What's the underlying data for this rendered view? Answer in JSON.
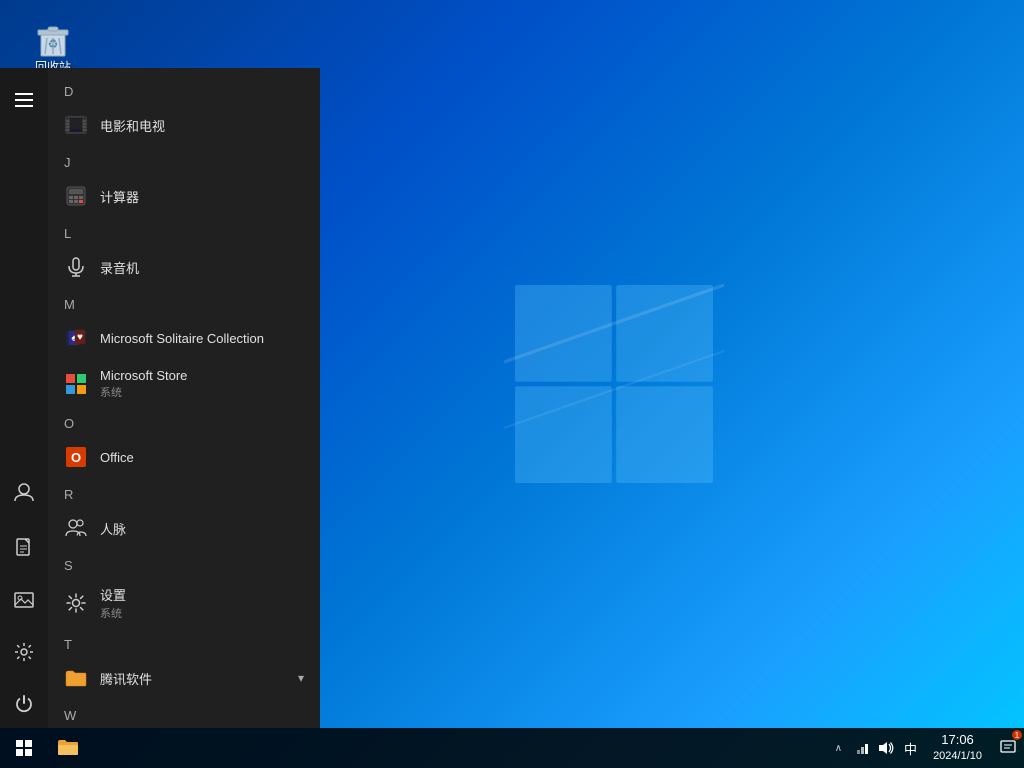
{
  "desktop": {
    "background_description": "Windows 10 blue gradient desktop",
    "icon_recycle": "回收站"
  },
  "start_menu": {
    "sections": [
      {
        "letter": "D",
        "items": [
          {
            "name": "电影和电视",
            "sub": "",
            "icon_type": "movie"
          }
        ]
      },
      {
        "letter": "J",
        "items": [
          {
            "name": "计算器",
            "sub": "",
            "icon_type": "calculator"
          }
        ]
      },
      {
        "letter": "L",
        "items": [
          {
            "name": "录音机",
            "sub": "",
            "icon_type": "microphone"
          }
        ]
      },
      {
        "letter": "M",
        "items": [
          {
            "name": "Microsoft Solitaire Collection",
            "sub": "",
            "icon_type": "solitaire"
          },
          {
            "name": "Microsoft Store",
            "sub": "系统",
            "icon_type": "store"
          }
        ]
      },
      {
        "letter": "O",
        "items": [
          {
            "name": "Office",
            "sub": "",
            "icon_type": "office"
          }
        ]
      },
      {
        "letter": "R",
        "items": [
          {
            "name": "人脉",
            "sub": "",
            "icon_type": "people"
          }
        ]
      },
      {
        "letter": "S",
        "items": [
          {
            "name": "设置",
            "sub": "系统",
            "icon_type": "settings"
          }
        ]
      },
      {
        "letter": "T",
        "items": [
          {
            "name": "腾讯软件",
            "sub": "",
            "icon_type": "folder",
            "has_arrow": true
          }
        ]
      },
      {
        "letter": "W",
        "items": []
      }
    ]
  },
  "sidebar": {
    "icons": [
      {
        "name": "hamburger-menu",
        "label": "菜单"
      },
      {
        "name": "user-icon",
        "label": "用户"
      },
      {
        "name": "document-icon",
        "label": "文档"
      },
      {
        "name": "photo-icon",
        "label": "图片"
      },
      {
        "name": "settings-icon",
        "label": "设置"
      },
      {
        "name": "power-icon",
        "label": "电源"
      }
    ]
  },
  "taskbar": {
    "start_label": "开始",
    "pinned": [
      {
        "name": "file-explorer",
        "label": "文件资源管理器"
      }
    ],
    "systray": {
      "chevron": "^",
      "network": "网络",
      "volume": "音量",
      "ime": "中"
    },
    "clock": {
      "time": "17:06",
      "date": "2024/1/10"
    },
    "notification_count": "1"
  }
}
